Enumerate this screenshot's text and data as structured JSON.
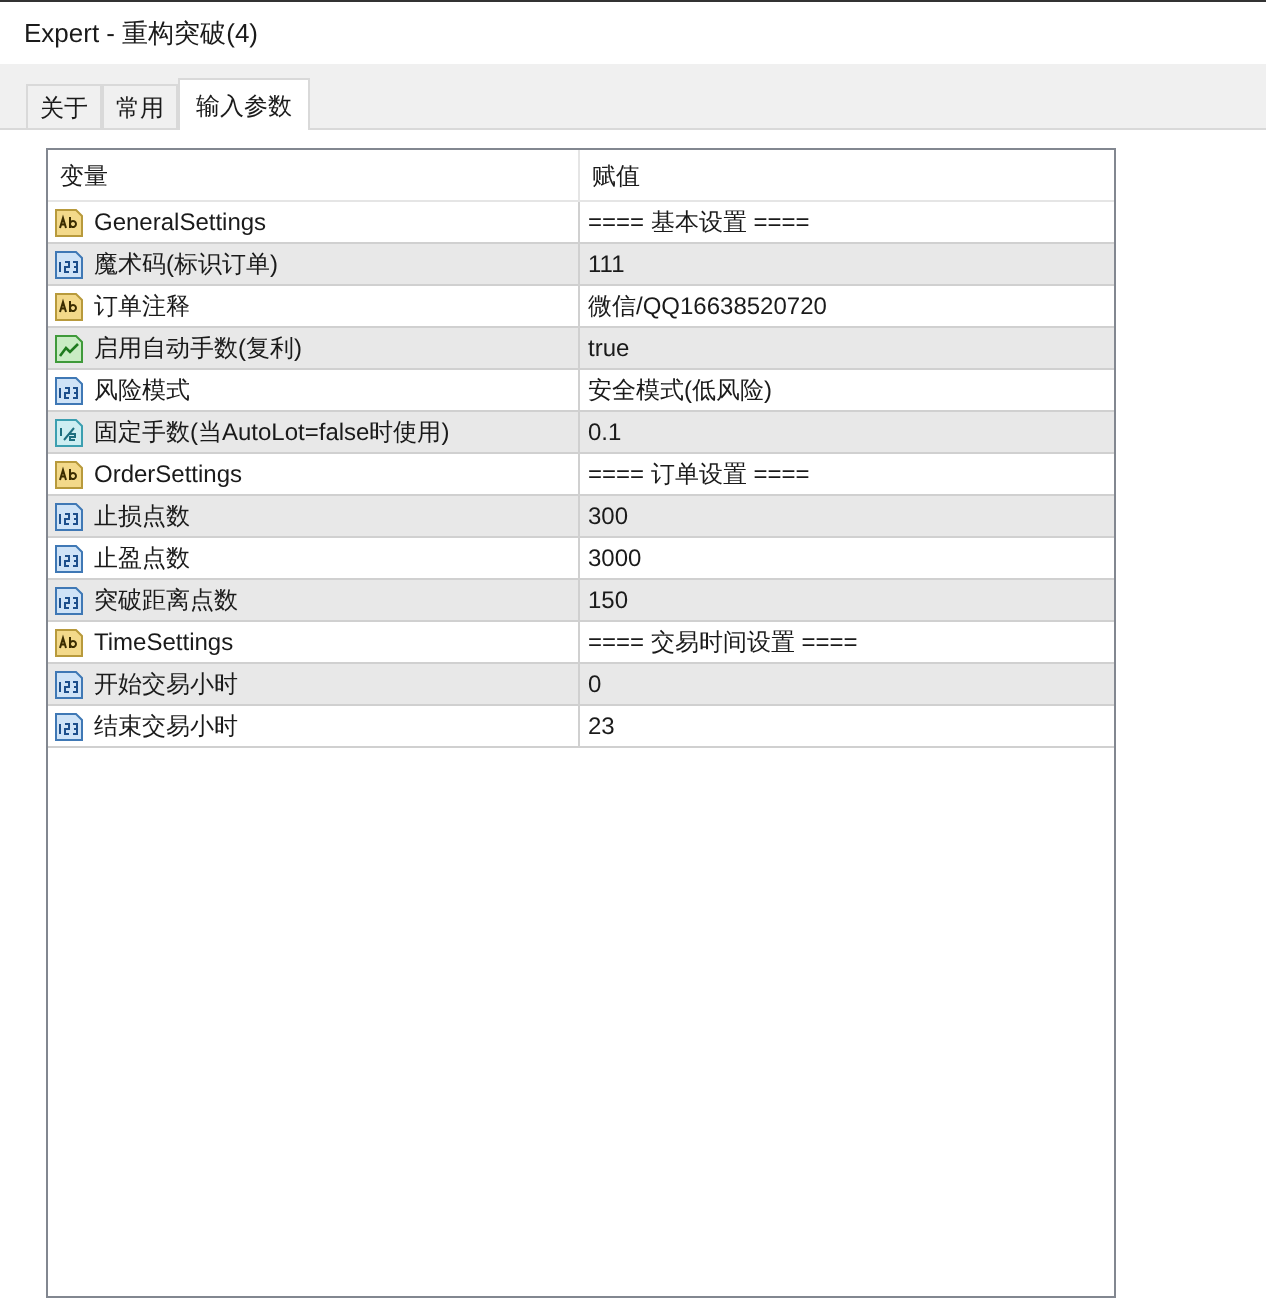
{
  "window": {
    "title": "Expert - 重构突破(4)"
  },
  "tabs": [
    {
      "label": "关于",
      "selected": false
    },
    {
      "label": "常用",
      "selected": false
    },
    {
      "label": "输入参数",
      "selected": true
    }
  ],
  "table": {
    "columns": [
      "变量",
      "赋值"
    ],
    "rows": [
      {
        "kind": "string",
        "name": "GeneralSettings",
        "value": "==== 基本设置 ===="
      },
      {
        "kind": "integer",
        "name": "魔术码(标识订单)",
        "value": "111"
      },
      {
        "kind": "string",
        "name": "订单注释",
        "value": "微信/QQ16638520720"
      },
      {
        "kind": "boolean",
        "name": "启用自动手数(复利)",
        "value": "true"
      },
      {
        "kind": "integer",
        "name": "风险模式",
        "value": "安全模式(低风险)"
      },
      {
        "kind": "double",
        "name": "固定手数(当AutoLot=false时使用)",
        "value": "0.1"
      },
      {
        "kind": "string",
        "name": "OrderSettings",
        "value": "==== 订单设置 ===="
      },
      {
        "kind": "integer",
        "name": "止损点数",
        "value": "300"
      },
      {
        "kind": "integer",
        "name": "止盈点数",
        "value": "3000"
      },
      {
        "kind": "integer",
        "name": "突破距离点数",
        "value": "150"
      },
      {
        "kind": "string",
        "name": "TimeSettings",
        "value": "==== 交易时间设置 ===="
      },
      {
        "kind": "integer",
        "name": "开始交易小时",
        "value": "0"
      },
      {
        "kind": "integer",
        "name": "结束交易小时",
        "value": "23"
      }
    ]
  }
}
